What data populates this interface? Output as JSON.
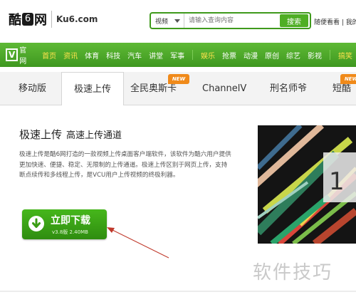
{
  "header": {
    "logo_text": "酷",
    "logo_b": "6",
    "logo_text2": "网",
    "logo_domain": "Ku6.com",
    "search": {
      "category": "视频",
      "placeholder": "请输入查询内容",
      "button": "搜索"
    },
    "top_links": "随便看看 | 我的"
  },
  "nav": {
    "brand": "官网",
    "items": [
      {
        "label": "首页",
        "highlight": true
      },
      {
        "label": "资讯",
        "highlight": true
      },
      {
        "label": "体育",
        "highlight": false
      },
      {
        "label": "科技",
        "highlight": false
      },
      {
        "label": "汽车",
        "highlight": false
      },
      {
        "label": "讲堂",
        "highlight": false
      },
      {
        "label": "军事",
        "highlight": false
      },
      {
        "label": "娱乐",
        "highlight": true
      },
      {
        "label": "抢票",
        "highlight": false
      },
      {
        "label": "动漫",
        "highlight": false
      },
      {
        "label": "原创",
        "highlight": false
      },
      {
        "label": "综艺",
        "highlight": false
      },
      {
        "label": "影视",
        "highlight": false
      },
      {
        "label": "搞笑",
        "highlight": true
      }
    ]
  },
  "tabs": [
    {
      "label": "移动版",
      "badge": ""
    },
    {
      "label": "极速上传",
      "badge": "NEW"
    },
    {
      "label": "全民奥斯卡",
      "badge": ""
    },
    {
      "label": "ChannelV",
      "badge": ""
    },
    {
      "label": "刑名师爷",
      "badge": ""
    },
    {
      "label": "短酷",
      "badge": "NEW"
    }
  ],
  "main": {
    "title": "极速上传",
    "subtitle": "高速上传通道",
    "description": "极速上传是酷6网打造的一款视频上传桌面客户端软件，该软件为酷六用户提供更加快速、便捷、稳定、无限制的上传通道。极速上传区别于网页上传，支持断点续传和多线程上传，是VCU用户上传视频的终极利器。",
    "download": {
      "label": "立即下载",
      "version": "v3.8版 2.40MB"
    }
  },
  "watermark": "软件技巧",
  "colors": {
    "brand_green": "#4fae24",
    "nav_highlight": "#ffe34d",
    "badge_orange": "#f08a1a"
  }
}
